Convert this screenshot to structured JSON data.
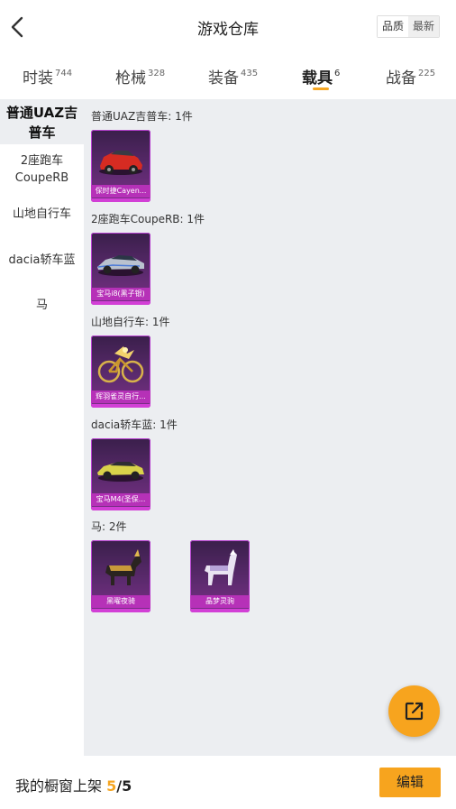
{
  "header": {
    "title": "游戏仓库",
    "sort_quality": "品质",
    "sort_newest": "最新"
  },
  "tabs": [
    {
      "label": "时装",
      "count": "744"
    },
    {
      "label": "枪械",
      "count": "328"
    },
    {
      "label": "装备",
      "count": "435"
    },
    {
      "label": "载具",
      "count": "6"
    },
    {
      "label": "战备",
      "count": "225"
    }
  ],
  "sidebar": {
    "items": [
      {
        "label": "普通UAZ吉普车"
      },
      {
        "label": "2座跑车CoupeRB"
      },
      {
        "label": "山地自行车"
      },
      {
        "label": "dacia轿车蓝"
      },
      {
        "label": "马"
      }
    ]
  },
  "sections": [
    {
      "title": "普通UAZ吉普车: 1件",
      "items": [
        {
          "name": "保时捷Cayen..."
        }
      ]
    },
    {
      "title": "2座跑车CoupeRB: 1件",
      "items": [
        {
          "name": "宝马i8(黑子银)"
        }
      ]
    },
    {
      "title": "山地自行车: 1件",
      "items": [
        {
          "name": "辉羽雀灵自行..."
        }
      ]
    },
    {
      "title": "dacia轿车蓝: 1件",
      "items": [
        {
          "name": "宝马M4(圣保..."
        }
      ]
    },
    {
      "title": "马: 2件",
      "items": [
        {
          "name": "黑曜夜骑"
        },
        {
          "name": "晶梦灵驹"
        }
      ]
    }
  ],
  "footer": {
    "label": "我的橱窗上架",
    "shown": "5",
    "separator": "/",
    "total": "5",
    "edit_label": "编辑"
  },
  "colors": {
    "accent": "#f7a41e",
    "card_purple": "#5b2a6d",
    "panel_bg": "#eceef1"
  }
}
